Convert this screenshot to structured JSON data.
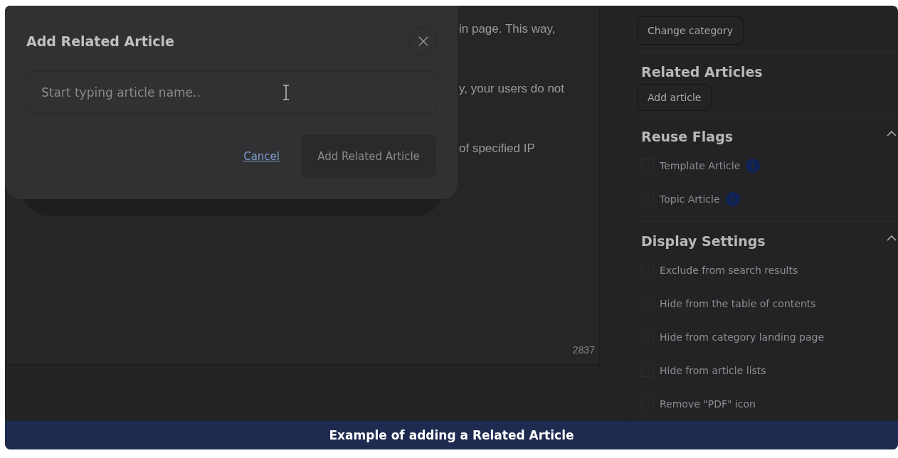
{
  "editor": {
    "lines": [
      "in page. This way,",
      "y, your users do not",
      "of specified IP"
    ],
    "character_count": "2837"
  },
  "sidebar": {
    "change_category_button": "Change category",
    "sections": [
      {
        "title": "Related Articles",
        "kind": "button",
        "button": "Add article"
      },
      {
        "title": "Reuse Flags",
        "kind": "checkboxes",
        "expanded": true,
        "items": [
          {
            "label": "Template Article",
            "checked": false,
            "info": true
          },
          {
            "label": "Topic Article",
            "checked": false,
            "info": true
          }
        ]
      },
      {
        "title": "Display Settings",
        "kind": "checkboxes",
        "expanded": true,
        "items": [
          {
            "label": "Exclude from search results",
            "checked": false,
            "info": false
          },
          {
            "label": "Hide from the table of contents",
            "checked": false,
            "info": false
          },
          {
            "label": "Hide from category landing page",
            "checked": false,
            "info": false
          },
          {
            "label": "Hide from article lists",
            "checked": false,
            "info": false
          },
          {
            "label": "Remove \"PDF\" icon",
            "checked": false,
            "info": false
          }
        ]
      }
    ]
  },
  "dialog": {
    "title": "Add Related Article",
    "search": {
      "placeholder": "Start typing article name.."
    },
    "cancel": "Cancel",
    "submit": {
      "label": "Add Related Article",
      "disabled": true
    }
  },
  "caption": "Example of adding a Related Article"
}
